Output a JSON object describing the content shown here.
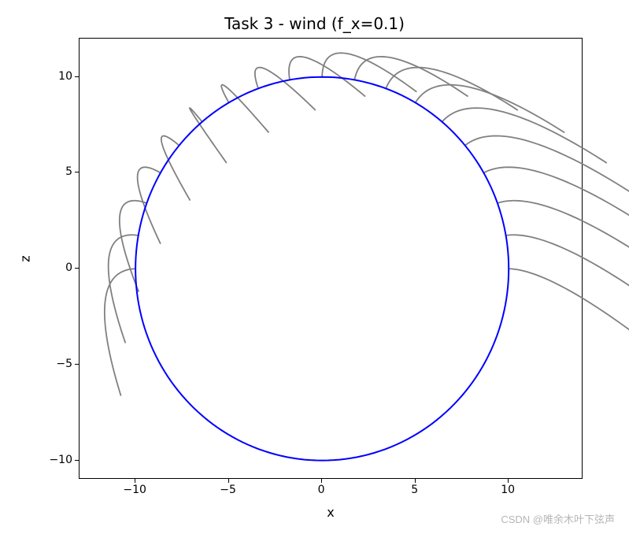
{
  "chart_data": {
    "type": "line",
    "title": "Task 3 - wind (f_x=0.1)",
    "xlabel": "x",
    "ylabel": "z",
    "xlim": [
      -13,
      14
    ],
    "ylim": [
      -11,
      12
    ],
    "x_ticks": [
      -10,
      -5,
      0,
      5,
      10
    ],
    "y_ticks": [
      -10,
      -5,
      0,
      5,
      10
    ],
    "series": [
      {
        "name": "circle",
        "type": "parametric-circle",
        "color": "#0000ff",
        "center": [
          0,
          0
        ],
        "radius": 10
      },
      {
        "name": "wind-trajectories",
        "type": "projectile-arcs",
        "color": "#808080",
        "start_on_circle_radius": 10,
        "launch_angles_deg": [
          0,
          10,
          20,
          30,
          40,
          50,
          60,
          70,
          80,
          90,
          100,
          110,
          120,
          130,
          140,
          150,
          160,
          170,
          180
        ],
        "f_x": 0.1,
        "note": "Each gray curve starts at a point on the upper half of the circle and arcs toward +x under horizontal wind and gravity. Approximate end x-offsets increase toward the right side; curves emanate outward from perimeter."
      }
    ]
  },
  "watermark": "CSDN @唯余木叶下弦声"
}
